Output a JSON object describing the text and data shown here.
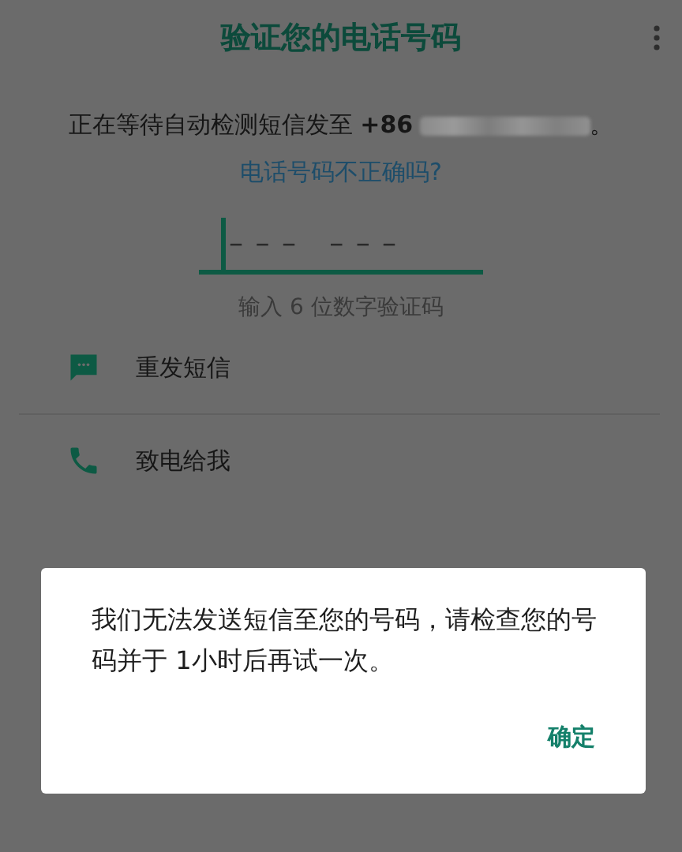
{
  "app_bar": {
    "title": "验证您的电话号码"
  },
  "instructions": {
    "text": "正在等待自动检测短信发至 **+86**",
    "number_redacted": true,
    "period": "。",
    "link": "电话号码不正确吗?"
  },
  "code_input": {
    "placeholder": "– – –   – – –"
  },
  "hint": "输入 6 位数字验证码",
  "options": [
    {
      "kind": "sms",
      "label": "重发短信"
    },
    {
      "kind": "call",
      "label": "致电给我"
    }
  ],
  "dialog": {
    "message": "我们无法发送短信至您的号码，请检查您的号码并于 1小时后再试一次。",
    "button": "确定"
  }
}
